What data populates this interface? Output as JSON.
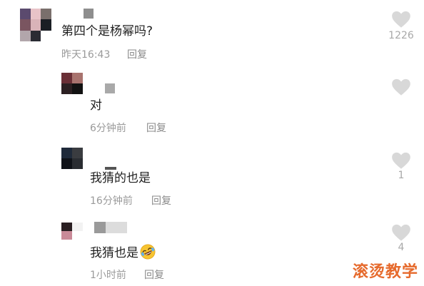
{
  "comments": [
    {
      "text": "第四个是杨幂吗?",
      "time": "昨天16:43",
      "reply_label": "回复",
      "likes": "1226"
    },
    {
      "text": "对",
      "time": "6分钟前",
      "reply_label": "回复",
      "likes": ""
    },
    {
      "text": "我猜的也是",
      "time": "16分钟前",
      "reply_label": "回复",
      "likes": "1"
    },
    {
      "text": "我猜也是",
      "time": "1小时前",
      "reply_label": "回复",
      "likes": "4",
      "emoji": "rolling-laughing-emoji"
    }
  ],
  "watermark": "滚烫教学",
  "colors": {
    "heart": "#d8d8d8",
    "meta": "#9a9a9a",
    "watermark": "#e66a2c"
  }
}
